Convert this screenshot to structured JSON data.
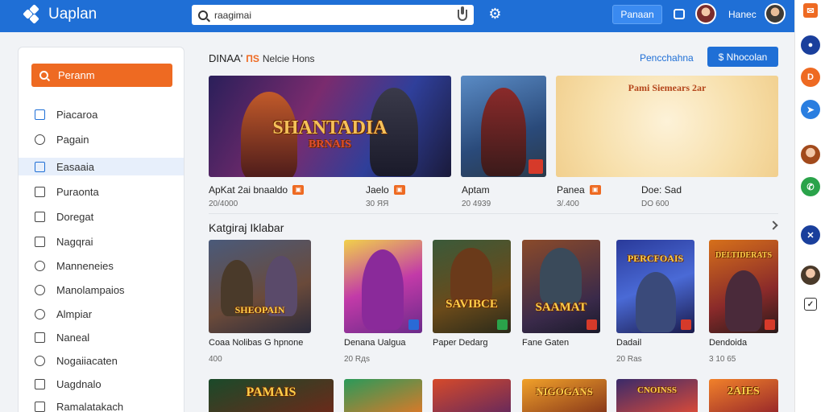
{
  "topbar": {
    "app_name": "Uaplan",
    "search_value": "raagimai",
    "button_label": "Panaan",
    "user_name": "Haneс"
  },
  "sidebar": {
    "search_label": "Peranm",
    "items": [
      {
        "label": "Piacaroa",
        "icon": "gamepad-icon"
      },
      {
        "label": "Pagain",
        "icon": "globe-icon"
      },
      {
        "label": "Easaaia",
        "icon": "image-icon"
      },
      {
        "label": "Puraonta",
        "icon": "list-icon"
      },
      {
        "label": "Doregat",
        "icon": "document-icon"
      },
      {
        "label": "Nagqrai",
        "icon": "monitor-icon"
      },
      {
        "label": "Manneneies",
        "icon": "controller-icon"
      },
      {
        "label": "Manolampaios",
        "icon": "globe-icon"
      },
      {
        "label": "Almpiar",
        "icon": "chat-icon"
      },
      {
        "label": "Naneal",
        "icon": "square-icon"
      },
      {
        "label": "Nogaiiacaten",
        "icon": "clock-icon"
      },
      {
        "label": "Uagdnalo",
        "icon": "tag-icon"
      },
      {
        "label": "Ramalatakach",
        "icon": "shield-icon"
      }
    ],
    "active_index": 2
  },
  "main": {
    "title": "DINAA'",
    "tag": "ПS",
    "subtitle": "Nelcie Hons",
    "link": "Pencchahna",
    "button": "$ Nhocolan"
  },
  "featured": [
    {
      "art_text": "SHANTADIA",
      "art_sub": "BRNAIS",
      "title": "ApKat 2ai bnaaldo",
      "meta": "20/4000"
    },
    {
      "title": "Jaelo",
      "meta": "30 ЯЯ"
    },
    {
      "title": "Aptam",
      "meta": "20 4939"
    },
    {
      "art_text": "Pami Siemears 2ar",
      "title": "Panea",
      "meta": "3/.400"
    },
    {
      "title": "Doe: Sad",
      "meta": "DO 600"
    }
  ],
  "section": {
    "title": "Katgiraj Iklabar"
  },
  "games": [
    {
      "art_text": "SHEOPAIN",
      "title": "Coaa Nolibas G hpnone",
      "meta": "400"
    },
    {
      "art_text": "",
      "title": "Denana Ualgua",
      "meta": "20 Rдs"
    },
    {
      "art_text": "SAVIBCE",
      "title": "Paper Dedarg",
      "meta": ""
    },
    {
      "art_text": "SAAMAT",
      "title": "Fane Gaten",
      "meta": ""
    },
    {
      "art_text": "PERCFOAIS",
      "title": "Dadail",
      "meta": "20 Ras"
    },
    {
      "art_text": "DELTIDERATS",
      "title": "Dendoida",
      "meta": "3 10 65"
    }
  ],
  "games_row2": [
    {
      "art_text": "PAMAIS"
    },
    {
      "art_text": ""
    },
    {
      "art_text": ""
    },
    {
      "art_text": "NIGOGANS"
    },
    {
      "art_text": "CNOINSS"
    },
    {
      "art_text": "2AIES"
    }
  ],
  "colors": {
    "brand": "#1f6fd6",
    "accent": "#ee6a22"
  }
}
